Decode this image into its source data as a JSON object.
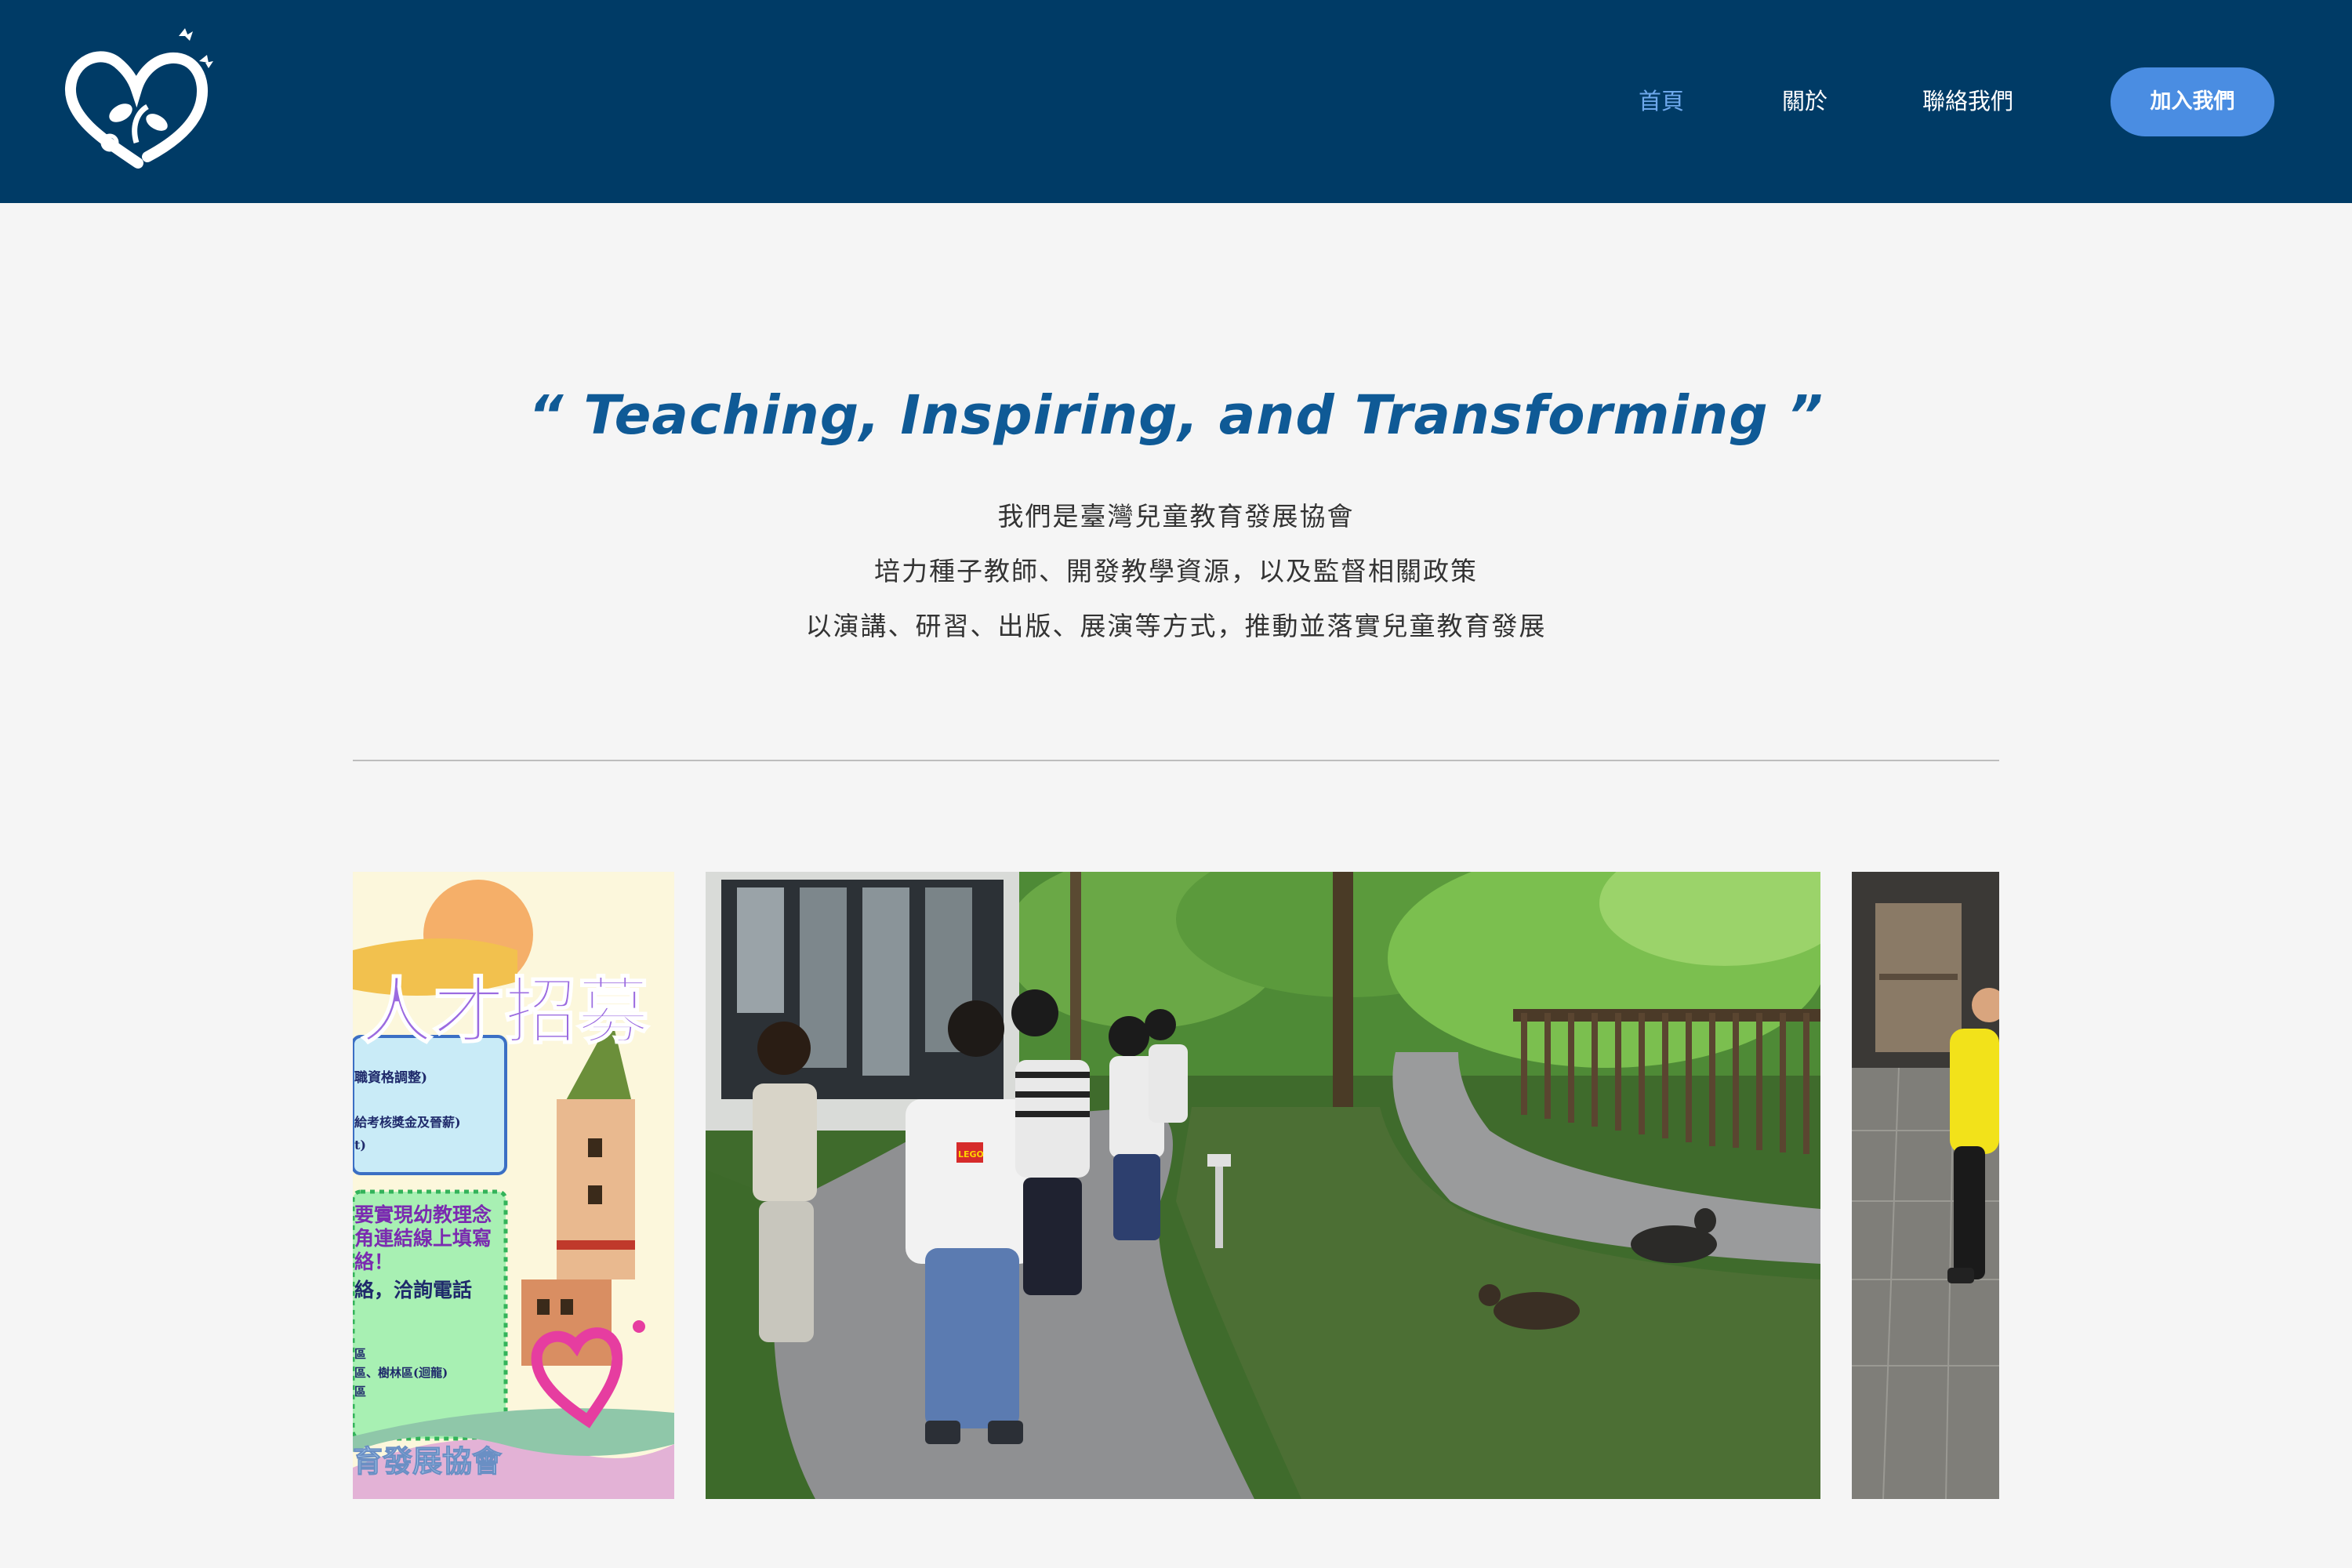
{
  "header": {
    "logo_icon": "heart-butterfly-logo-icon",
    "nav": {
      "home": "首頁",
      "about": "關於",
      "contact": "聯絡我們"
    },
    "join_button": "加入我們",
    "colors": {
      "background": "#003b66",
      "active_link": "#6ea8ec",
      "button": "#4a8de2"
    }
  },
  "hero": {
    "slogan": "“ Teaching, Inspiring, and Transforming ”",
    "lines": [
      "我們是臺灣兒童教育發展協會",
      "培力種子教師、開發教學資源，以及監督相關政策",
      "以演講、研習、出版、展演等方式，推動並落實兒童教育發展"
    ]
  },
  "gallery": {
    "left_poster": {
      "title": "人才招募",
      "lines": [
        "職資格調整)",
        "給考核獎金及晉薪)",
        "t)",
        "要實現幼教理念",
        "角連結線上填寫",
        "絡！",
        "絡，洽詢電話",
        "區",
        "區、樹林區(迴龍)",
        "區"
      ],
      "footer": "育發展協會"
    },
    "center_photo": "children-walking-garden-path-photo",
    "right_photo": "child-walking-tile-floor-photo",
    "shirt_text": "LEGO"
  }
}
